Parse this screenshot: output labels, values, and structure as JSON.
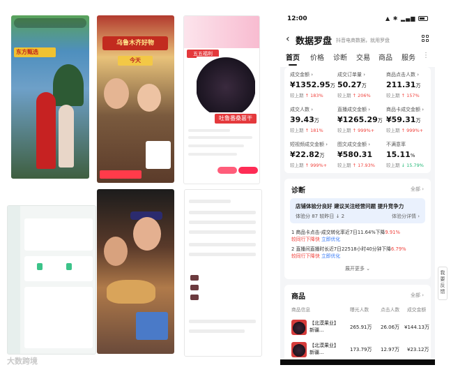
{
  "collage": {
    "shot1_banner": "东方甄选",
    "shot2_banner": "乌鲁木齐好物",
    "shot2_sign": "今天",
    "shot3_tag": "五五福利",
    "shot3_label": "吐鲁番桑葚干",
    "watermark": "大数跨境"
  },
  "status": {
    "time": "12:00"
  },
  "header": {
    "back_icon": "chevron-left-icon",
    "title": "数据罗盘",
    "subtitle": "抖音电商数据，就用罗盘",
    "grid_icon": "apps-grid-icon"
  },
  "tabs": [
    "首页",
    "价格",
    "诊断",
    "交易",
    "商品",
    "服务"
  ],
  "tabs_more": "⋮",
  "metrics": [
    {
      "label": "成交金额",
      "value": "¥1352.95",
      "unit": "万",
      "cmp": "较上期",
      "change": "183%",
      "dir": "up"
    },
    {
      "label": "成交订单量",
      "value": "50.27",
      "unit": "万",
      "cmp": "较上期",
      "change": "206%",
      "dir": "up"
    },
    {
      "label": "商品点击人数",
      "value": "211.31",
      "unit": "万",
      "cmp": "较上期",
      "change": "157%",
      "dir": "up"
    },
    {
      "label": "成交人数",
      "value": "39.43",
      "unit": "万",
      "cmp": "较上期",
      "change": "181%",
      "dir": "up"
    },
    {
      "label": "直播成交金额",
      "value": "¥1265.29",
      "unit": "万",
      "cmp": "较上期",
      "change": "999%+",
      "dir": "up"
    },
    {
      "label": "商品卡成交金额",
      "value": "¥59.31",
      "unit": "万",
      "cmp": "较上期",
      "change": "999%+",
      "dir": "up"
    },
    {
      "label": "短视频成交金额",
      "value": "¥22.82",
      "unit": "万",
      "cmp": "较上期",
      "change": "999%+",
      "dir": "up"
    },
    {
      "label": "图文成交金额",
      "value": "¥580.31",
      "unit": "",
      "cmp": "较上期",
      "change": "17.93%",
      "dir": "up"
    },
    {
      "label": "不满意率",
      "value": "15.11",
      "unit": "%",
      "cmp": "较上期",
      "change": "15.79%",
      "dir": "down"
    }
  ],
  "diagnosis": {
    "title": "诊断",
    "all_link": "全部 ›",
    "box_title": "店铺体验分良好 建议关注经营问题 提升竞争力",
    "box_score": "体验分 87  较昨日 ↓ 2",
    "box_detail": "体验分详情 ›",
    "issues": [
      {
        "text": "1 商品卡点击-成交转化率近7日11.64%下降",
        "red": "9.91%",
        "blue_prefix": "较同行下降快",
        "link": "立即优化"
      },
      {
        "text": "2 直播间直播时长近7日22518小时40分钟下降",
        "red": "6.79%",
        "blue_prefix": "较同行下降快",
        "link": "立即优化"
      }
    ],
    "expand": "展开更多 ⌄"
  },
  "goods": {
    "title": "商品",
    "all_link": "全部 ›",
    "headers": [
      "商品信息",
      "曝光人数",
      "点击人数",
      "成交金额"
    ],
    "rows": [
      {
        "name": "【北漠果业】新疆...",
        "exposure": "265.91万",
        "clicks": "26.06万",
        "amount": "¥144.13万"
      },
      {
        "name": "【北漠果业】新疆...",
        "exposure": "173.79万",
        "clicks": "12.97万",
        "amount": "¥23.12万"
      }
    ]
  },
  "side_tab": "我要反馈",
  "colors": {
    "up": "#f0423c",
    "down": "#1eb774",
    "link": "#3478f6"
  }
}
